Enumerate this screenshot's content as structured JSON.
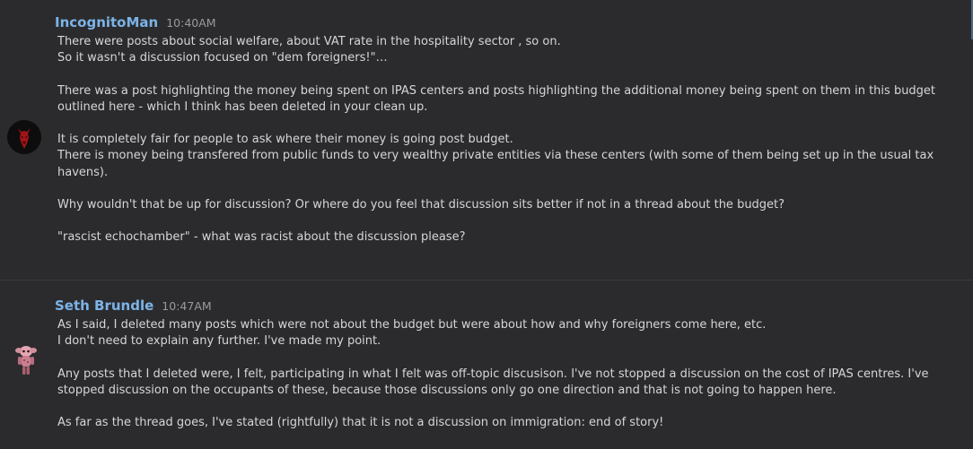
{
  "posts": [
    {
      "author": "IncognitoMan",
      "time": "10:40AM",
      "avatar_icon": "devil-mask-icon",
      "paragraphs": [
        "There were posts about social welfare, about VAT rate in the hospitality sector , so on.\nSo it wasn't a discussion focused on \"dem foreigners!\"…",
        "There was a post highlighting the money being spent on IPAS centers and posts highlighting the additional money being spent on them in this budget outlined here - which I think has been deleted in your clean up.",
        "It is completely fair for people to ask where their money is going post budget.\nThere is money being transfered from public funds to very wealthy private entities via these centers (with some of them being set up in the usual tax havens).",
        "Why wouldn't that be up for discussion? Or where do you feel that discussion sits better if not in a thread about the budget?",
        "\"rascist echochamber\" - what was racist about the discussion please?"
      ]
    },
    {
      "author": "Seth Brundle",
      "time": "10:47AM",
      "avatar_icon": "pink-creature-icon",
      "paragraphs": [
        "As I said, I deleted many posts which were not about the budget but were about how and why foreigners come here, etc.\nI don't need to explain any further. I've made my point.",
        "Any posts that I deleted were, I felt, participating in what I felt was off-topic discusison. I've not stopped a discussion on the cost of IPAS centres. I've stopped discussion on the occupants of these, because those discussions only go one direction and that is not going to happen here.",
        "As far as the thread goes, I've stated (rightfully) that it is not a discussion on immigration: end of story!"
      ]
    }
  ],
  "colors": {
    "background": "#2b2b2e",
    "author": "#7cb4e6",
    "text": "#d6d6d6",
    "timestamp": "#9a9a9a"
  }
}
